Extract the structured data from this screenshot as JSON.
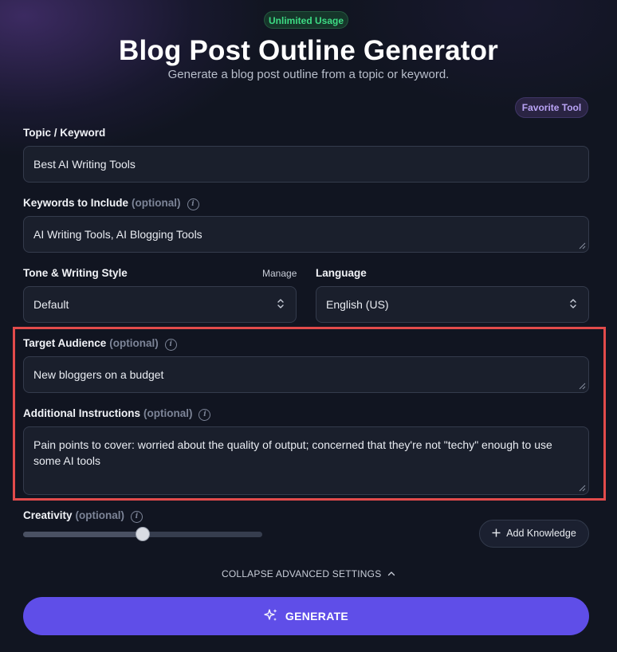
{
  "header": {
    "badge": "Unlimited Usage",
    "title": "Blog Post Outline Generator",
    "subtitle": "Generate a blog post outline from a topic or keyword.",
    "favorite_label": "Favorite Tool"
  },
  "form": {
    "topic": {
      "label": "Topic / Keyword",
      "value": "Best AI Writing Tools"
    },
    "keywords": {
      "label": "Keywords to Include",
      "optional": "(optional)",
      "value": "AI Writing Tools, AI Blogging Tools"
    },
    "tone": {
      "label": "Tone & Writing Style",
      "manage_label": "Manage",
      "value": "Default"
    },
    "language": {
      "label": "Language",
      "value": "English (US)"
    },
    "audience": {
      "label": "Target Audience",
      "optional": "(optional)",
      "value": "New bloggers on a budget"
    },
    "instructions": {
      "label": "Additional Instructions",
      "optional": "(optional)",
      "value": "Pain points to cover: worried about the quality of output; concerned that they're not \"techy\" enough to use some AI tools"
    },
    "creativity": {
      "label": "Creativity",
      "optional": "(optional)",
      "level": 0.5
    }
  },
  "actions": {
    "add_knowledge": "Add Knowledge",
    "collapse": "COLLAPSE ADVANCED SETTINGS",
    "generate": "GENERATE"
  },
  "icons": {
    "info": "info-icon",
    "chevron_select": "select-chevrons-icon",
    "plus": "plus-icon",
    "sparkle": "sparkle-icon",
    "chevron_up": "chevron-up-icon"
  },
  "colors": {
    "accent": "#5f4ee8",
    "badge_green": "#3ddc84",
    "highlight_red": "#e24b4b",
    "favorite_purple": "#b9a3f5"
  }
}
